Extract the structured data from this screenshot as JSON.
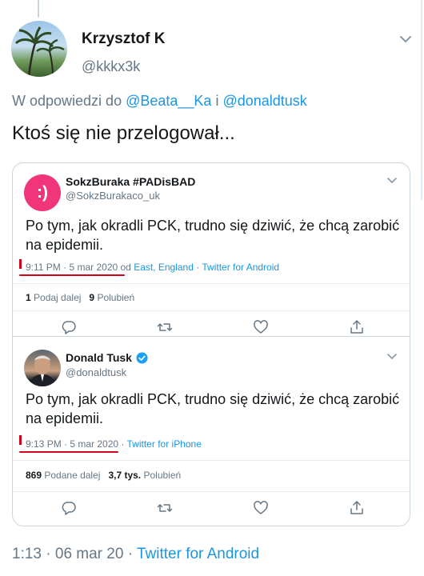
{
  "main_tweet": {
    "author_name": "Krzysztof K",
    "handle": "@kkkx3k",
    "reply_prefix": "W odpowiedzi do ",
    "reply_mentions": [
      "@Beata__Ka",
      "@donaldtusk"
    ],
    "reply_conj": " i ",
    "text": "Ktoś się nie przelogował...",
    "meta": {
      "time": "1:13",
      "date": "06 mar 20",
      "sep": " · ",
      "client": "Twitter for Android"
    }
  },
  "quoted_tweets": [
    {
      "avatar_text": ":)",
      "author_name": "SokzBuraka #PADisBAD",
      "handle": "@SokzBurakaco_uk",
      "text": "Po tym, jak okradli PCK, trudno się dziwić, że chcą zarobić na epidemii.",
      "time_date": "9:11 PM · 5 mar 2020",
      "location_prefix": " od ",
      "location": "East, England",
      "sep": " · ",
      "client": "Twitter for Android",
      "retweets_count": "1",
      "retweets_label": "Podaj dalej",
      "likes_count": "9",
      "likes_label": "Polubień"
    },
    {
      "author_name": "Donald Tusk",
      "handle": "@donaldtusk",
      "text": "Po tym, jak okradli PCK, trudno się dziwić, że chcą zarobić na epidemii.",
      "time_date": "9:13 PM · 5 mar 2020",
      "sep": " · ",
      "client": "Twitter for iPhone",
      "retweets_count": "869",
      "retweets_label": "Podane dalej",
      "likes_count": "3,7 tys.",
      "likes_label": "Polubień"
    }
  ],
  "colors": {
    "link": "#1b95e0",
    "muted": "#657786",
    "annotation_red": "#d0021b",
    "avatar_pink": "#f0357a"
  },
  "icons": [
    "chevron-down-icon",
    "reply-icon",
    "retweet-icon",
    "like-icon",
    "share-icon",
    "verified-badge-icon"
  ]
}
